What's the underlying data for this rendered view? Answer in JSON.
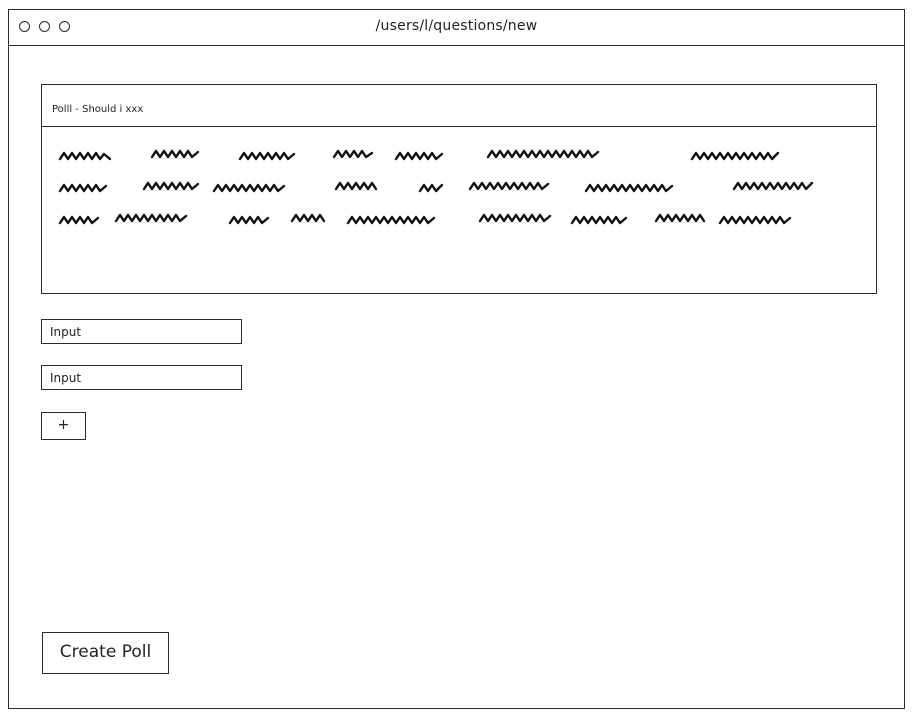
{
  "window": {
    "url": "/users/l/questions/new"
  },
  "panel": {
    "title": "Polll  - Should i xxx"
  },
  "inputs": [
    {
      "placeholder": "Input"
    },
    {
      "placeholder": "Input"
    }
  ],
  "add_button": {
    "label": "+"
  },
  "create_button": {
    "label": "Create Poll"
  },
  "icons": {
    "window_controls": [
      "circle-icon",
      "circle-icon",
      "circle-icon"
    ]
  }
}
